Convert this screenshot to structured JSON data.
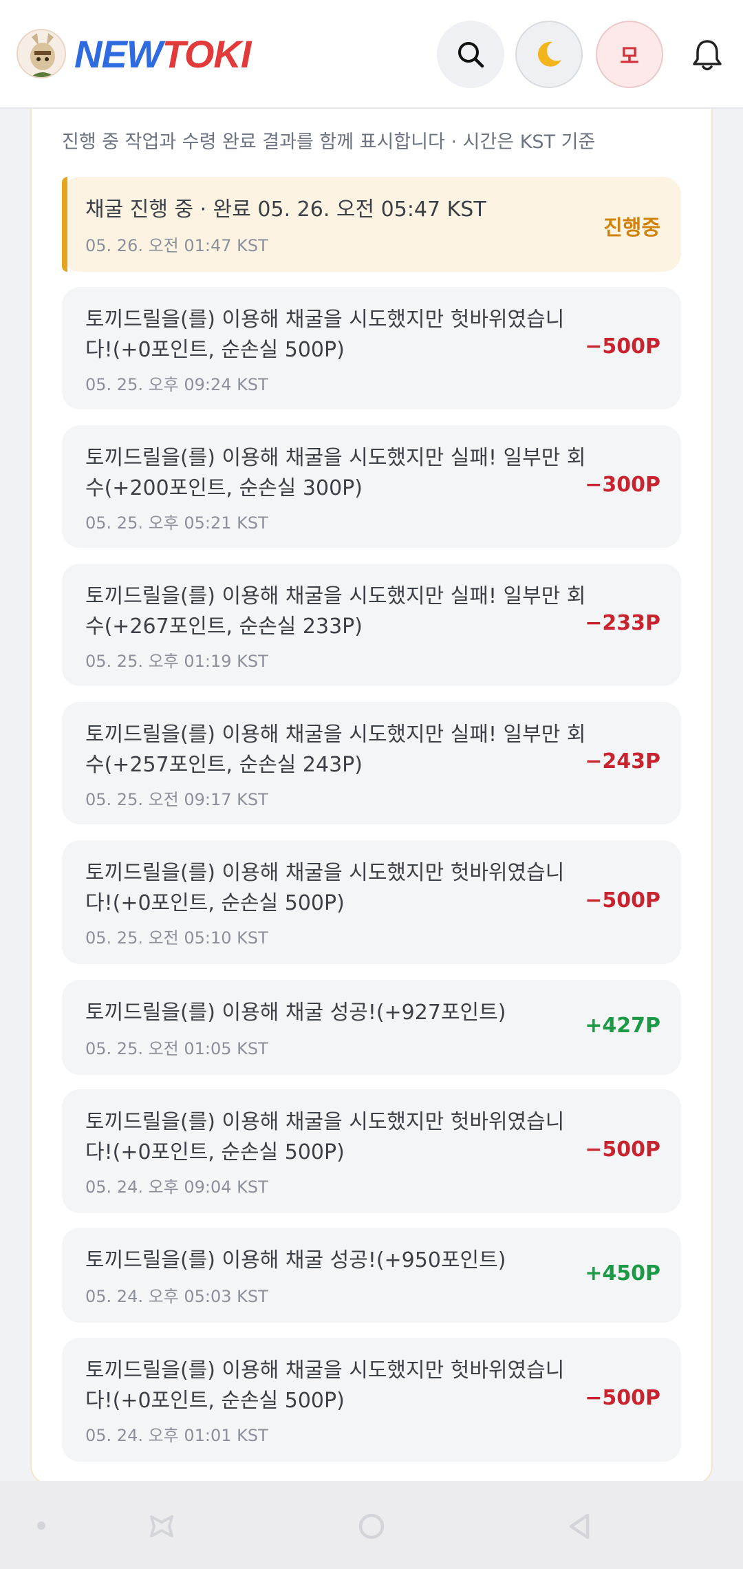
{
  "header": {
    "logo_new": "NEW",
    "logo_toki": "TOKI",
    "user_initial": "모",
    "icons": [
      "search-icon",
      "moon-icon",
      "bell-icon"
    ]
  },
  "subtitle": "진행 중 작업과 수령 완료 결과를 함께 표시합니다 · 시간은 KST 기준",
  "items": [
    {
      "text": "채굴 진행 중 · 완료 05. 26. 오전 05:47 KST",
      "time": "05. 26. 오전 01:47 KST",
      "amount": "진행중",
      "kind": "progress"
    },
    {
      "text": "토끼드릴을(를) 이용해 채굴을 시도했지만 헛바위였습니다!(+0포인트, 순손실 500P)",
      "time": "05. 25. 오후 09:24 KST",
      "amount": "−500P",
      "kind": "neg"
    },
    {
      "text": "토끼드릴을(를) 이용해 채굴을 시도했지만 실패! 일부만 회수(+200포인트, 순손실 300P)",
      "time": "05. 25. 오후 05:21 KST",
      "amount": "−300P",
      "kind": "neg"
    },
    {
      "text": "토끼드릴을(를) 이용해 채굴을 시도했지만 실패! 일부만 회수(+267포인트, 순손실 233P)",
      "time": "05. 25. 오후 01:19 KST",
      "amount": "−233P",
      "kind": "neg"
    },
    {
      "text": "토끼드릴을(를) 이용해 채굴을 시도했지만 실패! 일부만 회수(+257포인트, 순손실 243P)",
      "time": "05. 25. 오전 09:17 KST",
      "amount": "−243P",
      "kind": "neg"
    },
    {
      "text": "토끼드릴을(를) 이용해 채굴을 시도했지만 헛바위였습니다!(+0포인트, 순손실 500P)",
      "time": "05. 25. 오전 05:10 KST",
      "amount": "−500P",
      "kind": "neg"
    },
    {
      "text": "토끼드릴을(를) 이용해 채굴 성공!(+927포인트)",
      "time": "05. 25. 오전 01:05 KST",
      "amount": "+427P",
      "kind": "pos"
    },
    {
      "text": "토끼드릴을(를) 이용해 채굴을 시도했지만 헛바위였습니다!(+0포인트, 순손실 500P)",
      "time": "05. 24. 오후 09:04 KST",
      "amount": "−500P",
      "kind": "neg"
    },
    {
      "text": "토끼드릴을(를) 이용해 채굴 성공!(+950포인트)",
      "time": "05. 24. 오후 05:03 KST",
      "amount": "+450P",
      "kind": "pos"
    },
    {
      "text": "토끼드릴을(를) 이용해 채굴을 시도했지만 헛바위였습니다!(+0포인트, 순손실 500P)",
      "time": "05. 24. 오후 01:01 KST",
      "amount": "−500P",
      "kind": "neg"
    }
  ],
  "colors": {
    "negative": "#c8242f",
    "positive": "#1b9a46",
    "in_progress": "#d0830a",
    "progress_bar": "#e4a61c"
  },
  "navbar": {
    "icons": [
      "menu-icon",
      "home-icon",
      "back-icon"
    ]
  }
}
